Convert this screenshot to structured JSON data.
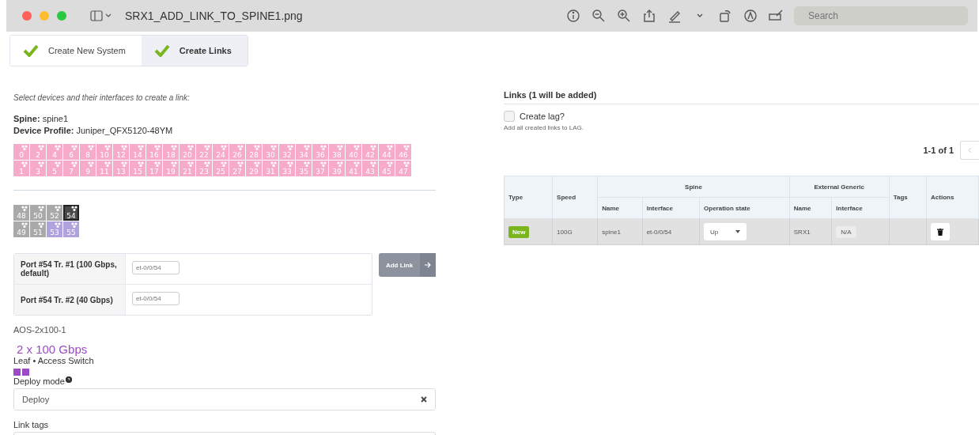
{
  "window": {
    "title": "SRX1_ADD_LINK_TO_SPINE1.png",
    "search_placeholder": "Search"
  },
  "steps": [
    {
      "label": "Create New System",
      "selected": false
    },
    {
      "label": "Create Links",
      "selected": true
    }
  ],
  "left": {
    "instruction": "Select devices and their interfaces to create a link:",
    "spine_label": "Spine:",
    "spine_value": "spine1",
    "profile_label": "Device Profile:",
    "profile_value": "Juniper_QFX5120-48YM",
    "ports": [
      {
        "label": "0",
        "color": "#f7abcb",
        "selected": false
      },
      {
        "label": "1",
        "color": "#f7abcb",
        "selected": false
      },
      {
        "label": "2",
        "color": "#f7abcb",
        "selected": false
      },
      {
        "label": "3",
        "color": "#f7abcb",
        "selected": false
      },
      {
        "label": "4",
        "color": "#f7abcb",
        "selected": false
      },
      {
        "label": "5",
        "color": "#f7abcb",
        "selected": false
      },
      {
        "label": "6",
        "color": "#f7abcb",
        "selected": false
      },
      {
        "label": "7",
        "color": "#f7abcb",
        "selected": false
      },
      {
        "label": "8",
        "color": "#f7abcb",
        "selected": false
      },
      {
        "label": "9",
        "color": "#f7abcb",
        "selected": false
      },
      {
        "label": "10",
        "color": "#f7abcb",
        "selected": false
      },
      {
        "label": "11",
        "color": "#f7abcb",
        "selected": false
      },
      {
        "label": "12",
        "color": "#f7abcb",
        "selected": false
      },
      {
        "label": "13",
        "color": "#f7abcb",
        "selected": false
      },
      {
        "label": "14",
        "color": "#f7abcb",
        "selected": false
      },
      {
        "label": "15",
        "color": "#f7abcb",
        "selected": false
      },
      {
        "label": "16",
        "color": "#f7abcb",
        "selected": false
      },
      {
        "label": "17",
        "color": "#f7abcb",
        "selected": false
      },
      {
        "label": "18",
        "color": "#f7abcb",
        "selected": false
      },
      {
        "label": "19",
        "color": "#f7abcb",
        "selected": false
      },
      {
        "label": "20",
        "color": "#f7abcb",
        "selected": false
      },
      {
        "label": "21",
        "color": "#f7abcb",
        "selected": false
      },
      {
        "label": "22",
        "color": "#f7abcb",
        "selected": false
      },
      {
        "label": "23",
        "color": "#f7abcb",
        "selected": false
      },
      {
        "label": "24",
        "color": "#f7abcb",
        "selected": false
      },
      {
        "label": "25",
        "color": "#f7abcb",
        "selected": false
      },
      {
        "label": "26",
        "color": "#f7abcb",
        "selected": false
      },
      {
        "label": "27",
        "color": "#f7abcb",
        "selected": false
      },
      {
        "label": "28",
        "color": "#f7abcb",
        "selected": false
      },
      {
        "label": "29",
        "color": "#f7abcb",
        "selected": false
      },
      {
        "label": "30",
        "color": "#f7abcb",
        "selected": false
      },
      {
        "label": "31",
        "color": "#f7abcb",
        "selected": false
      },
      {
        "label": "32",
        "color": "#f7abcb",
        "selected": false
      },
      {
        "label": "33",
        "color": "#f7abcb",
        "selected": false
      },
      {
        "label": "34",
        "color": "#f7abcb",
        "selected": false
      },
      {
        "label": "35",
        "color": "#f7abcb",
        "selected": false
      },
      {
        "label": "36",
        "color": "#f7abcb",
        "selected": false
      },
      {
        "label": "37",
        "color": "#f7abcb",
        "selected": false
      },
      {
        "label": "38",
        "color": "#f7abcb",
        "selected": false
      },
      {
        "label": "39",
        "color": "#f7abcb",
        "selected": false
      },
      {
        "label": "40",
        "color": "#f7abcb",
        "selected": false
      },
      {
        "label": "41",
        "color": "#f7abcb",
        "selected": false
      },
      {
        "label": "42",
        "color": "#f7abcb",
        "selected": false
      },
      {
        "label": "43",
        "color": "#f7abcb",
        "selected": false
      },
      {
        "label": "44",
        "color": "#f7abcb",
        "selected": false
      },
      {
        "label": "45",
        "color": "#f7abcb",
        "selected": false
      },
      {
        "label": "46",
        "color": "#f7abcb",
        "selected": false
      },
      {
        "label": "47",
        "color": "#f7abcb",
        "selected": false
      }
    ],
    "uplink_ports": [
      {
        "label": "48",
        "color": "#a9a9a9",
        "selected": false
      },
      {
        "label": "49",
        "color": "#a9a9a9",
        "selected": false
      },
      {
        "label": "50",
        "color": "#a9a9a9",
        "selected": false
      },
      {
        "label": "51",
        "color": "#a9a9a9",
        "selected": false
      },
      {
        "label": "52",
        "color": "#a9a9a9",
        "selected": false
      },
      {
        "label": "53",
        "color": "#b0a2dc",
        "selected": false
      },
      {
        "label": "54",
        "color": "#4a4a4a",
        "selected": true
      },
      {
        "label": "55",
        "color": "#b0a2dc",
        "selected": false
      }
    ],
    "transforms": [
      {
        "label": "Port #54 Tr. #1 (100 Gbps, default)",
        "placeholder": "et-0/0/54"
      },
      {
        "label": "Port #54 Tr. #2 (40 Gbps)",
        "placeholder": "et-0/0/54"
      }
    ],
    "add_link": "Add Link",
    "profile_name": "AOS-2x100-1",
    "speed": "2 x 100 Gbps",
    "role": "Leaf • Access Switch",
    "deploy_label": "Deploy mode",
    "deploy_value": "Deploy",
    "tags_label": "Link tags"
  },
  "links": {
    "title": "Links (1 will be added)",
    "create_lag": {
      "label": "Create lag?",
      "checked": false
    },
    "lag_hint": "Add all created links to LAG.",
    "pagination": "1-1 of 1",
    "table": {
      "columns": [
        "Type",
        "Speed",
        "Tags",
        "Actions"
      ],
      "groups": [
        {
          "label": "Spine",
          "columns": [
            "Name",
            "Interface",
            "Operation state"
          ]
        },
        {
          "label": "External Generic",
          "columns": [
            "Name",
            "Interface"
          ]
        }
      ],
      "rows": [
        {
          "type": "New",
          "speed": "100G",
          "spine_name": "spine1",
          "spine_interface": "et-0/0/54",
          "operation_state": "Up",
          "external_name": "SRX1",
          "external_interface": "N/A"
        }
      ]
    }
  }
}
